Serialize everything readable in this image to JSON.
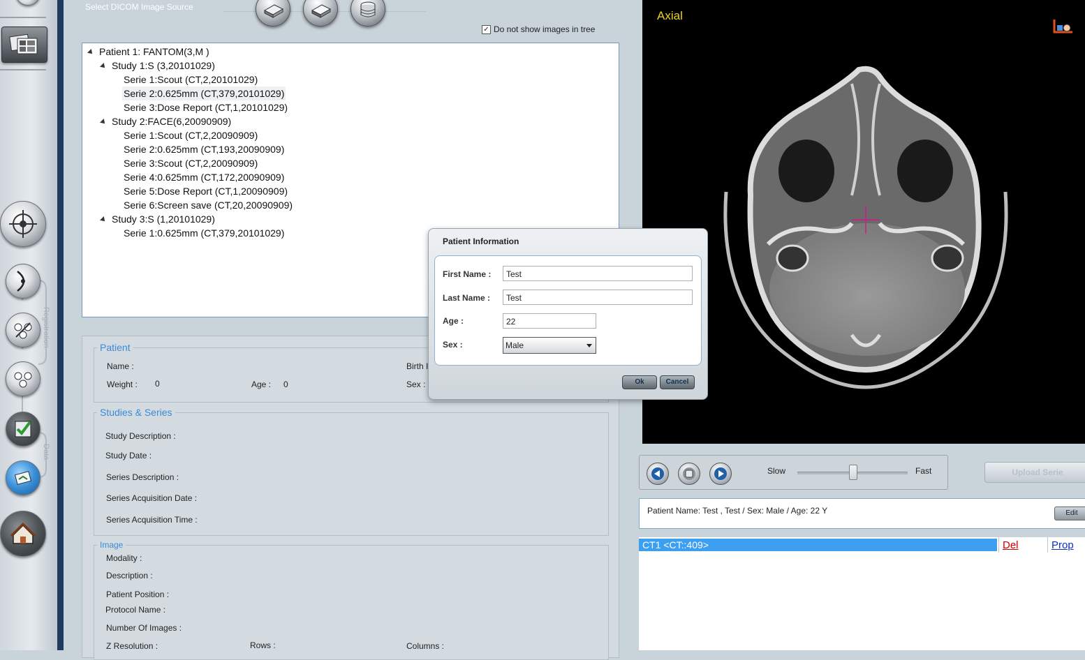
{
  "source": {
    "label": "Select DICOM Image Source",
    "hide_images_checkbox": {
      "label": "Do not show images in tree",
      "checked": true
    }
  },
  "left_toolbar": {
    "registration_label": "Registration",
    "data_label": "Data"
  },
  "tree": {
    "patient": "Patient 1: FANTOM(3,M )",
    "studies": [
      {
        "label": "Study 1:S (3,20101029)",
        "series": [
          "Serie 1:Scout (CT,2,20101029)",
          "Serie 2:0.625mm (CT,379,20101029)",
          "Serie 3:Dose Report (CT,1,20101029)"
        ]
      },
      {
        "label": "Study 2:FACE(6,20090909)",
        "series": [
          "Serie 1:Scout (CT,2,20090909)",
          "Serie 2:0.625mm (CT,193,20090909)",
          "Serie 3:Scout (CT,2,20090909)",
          "Serie 4:0.625mm (CT,172,20090909)",
          "Serie 5:Dose Report (CT,1,20090909)",
          "Serie 6:Screen save (CT,20,20090909)"
        ]
      },
      {
        "label": "Study 3:S (1,20101029)",
        "series": [
          "Serie 1:0.625mm (CT,379,20101029)"
        ]
      }
    ]
  },
  "patient_info": {
    "legend": "Patient",
    "name_label": "Name :",
    "birth_label": "Birth I",
    "weight_label": "Weight :",
    "weight_value": "0",
    "age_label": "Age :",
    "age_value": "0",
    "sex_label": "Sex :"
  },
  "studies_series": {
    "legend": "Studies & Series",
    "study_description": "Study Description :",
    "study_date": "Study Date :",
    "series_description": "Series Description :",
    "series_acq_date": "Series Acquisition Date :",
    "series_acq_time": "Series Acquisition Time :"
  },
  "image_info": {
    "legend": "Image",
    "modality": "Modality :",
    "description": "Description :",
    "patient_position": "Patient Position :",
    "protocol_name": "Protocol Name :",
    "number_of_images": "Number Of Images :",
    "z_resolution": "Z Resolution :",
    "rows": "Rows :",
    "columns": "Columns :"
  },
  "viewer": {
    "view_label": "Axial"
  },
  "playback": {
    "slow_label": "Slow",
    "fast_label": "Fast",
    "speed_level": 0.5,
    "upload_label": "Upload Serie"
  },
  "patient_bar": {
    "text": "Patient Name: Test , Test / Sex: Male / Age: 22 Y",
    "edit_label": "Edit"
  },
  "series_list": {
    "row_label": "CT1  <CT::409>",
    "del_label": "Del",
    "prop_label": "Prop"
  },
  "dialog": {
    "title": "Patient Information",
    "first_name_label": "First Name :",
    "first_name_value": "Test",
    "last_name_label": "Last Name :",
    "last_name_value": "Test",
    "age_label": "Age :",
    "age_value": "22",
    "sex_label": "Sex :",
    "sex_value": "Male",
    "ok_label": "Ok",
    "cancel_label": "Cancel"
  },
  "colors": {
    "accent": "#3a8ad6",
    "navy": "#1e3a5c",
    "axial_label": "#e8d51a",
    "selected_row": "#3d9ff0",
    "del_link": "#d00000",
    "prop_link": "#1030c0"
  }
}
